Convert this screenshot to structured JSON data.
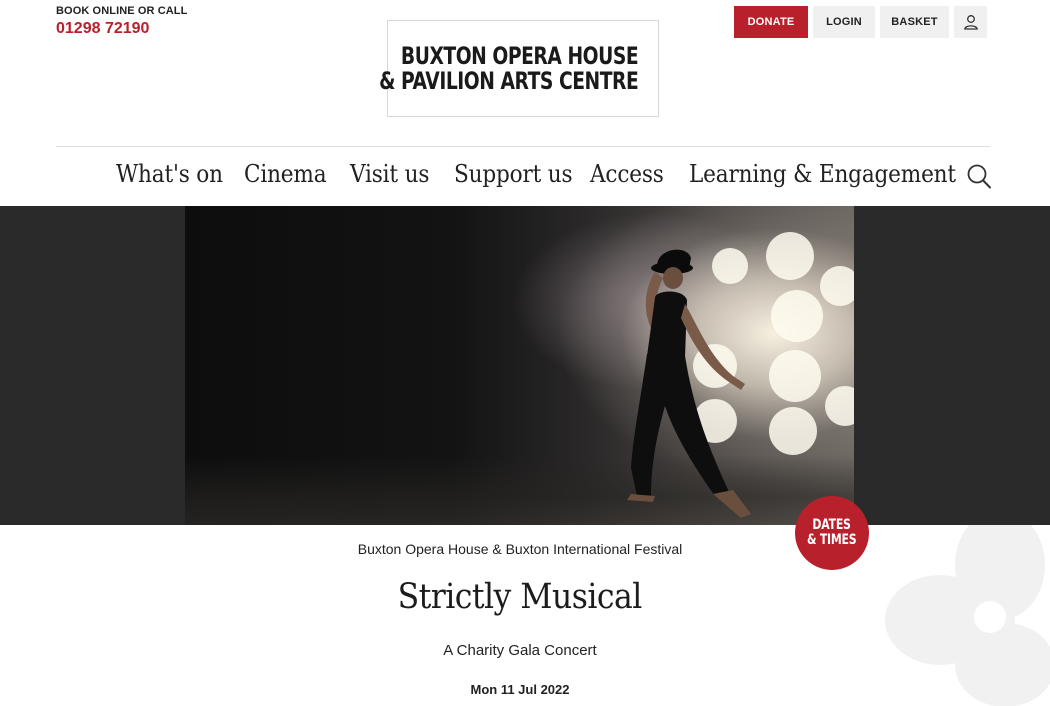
{
  "header": {
    "book_label": "BOOK ONLINE OR CALL",
    "phone": "01298 72190",
    "logo_line1": "BUXTON OPERA HOUSE",
    "logo_line2": "& PAVILION ARTS CENTRE",
    "actions": {
      "donate": "DONATE",
      "login": "LOGIN",
      "basket": "BASKET",
      "account_icon": "user-icon"
    }
  },
  "nav": {
    "items": [
      {
        "label": "What's on"
      },
      {
        "label": "Cinema"
      },
      {
        "label": "Visit us"
      },
      {
        "label": "Support us"
      },
      {
        "label": "Access"
      },
      {
        "label": "Learning & Engagement"
      }
    ],
    "search_icon": "search-icon"
  },
  "hero": {
    "badge_line1": "DATES",
    "badge_line2": "& TIMES"
  },
  "event": {
    "presenter": "Buxton Opera House & Buxton International Festival",
    "title": "Strictly Musical",
    "subtitle": "A Charity Gala Concert",
    "date": "Mon 11 Jul 2022"
  },
  "colors": {
    "brand_red": "#b8202c",
    "hero_band": "#2a2a2a",
    "button_grey": "#f0f0f0"
  }
}
